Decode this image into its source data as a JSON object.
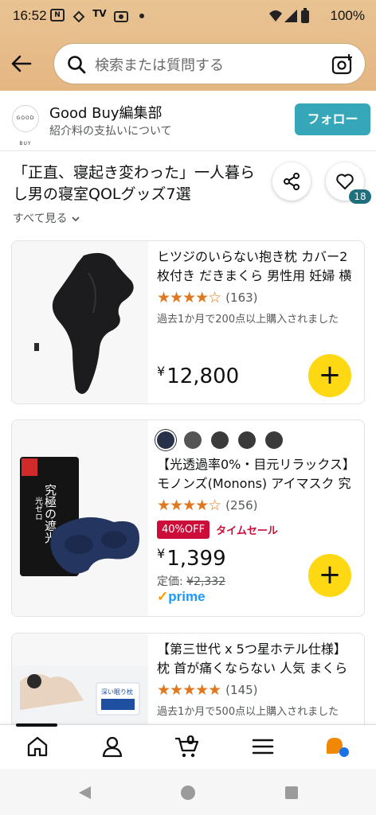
{
  "status": {
    "time": "16:52",
    "battery": "100%",
    "notif_icons": [
      "nuro-icon",
      "sync-icon",
      "tver-icon",
      "camera-app-icon"
    ]
  },
  "search": {
    "placeholder": "検索または質問する"
  },
  "influencer": {
    "name": "Good Buy編集部",
    "subtitle": "紹介料の支払いについて",
    "logo_text": "GOOD BUY",
    "follow_label": "フォロー"
  },
  "list": {
    "title": "「正直、寝起き変わった」一人暮らし男の寝室QOLグッズ7選",
    "see_all": "すべて見る",
    "likes": "18"
  },
  "products": [
    {
      "title": "ヒツジのいらない抱き枕 カバー2枚付き だきまくら 男性用 妊婦 横向き寝",
      "rating": 3.5,
      "stars": "★★★★☆",
      "reviews": "(163)",
      "bought": "過去1か月で200点以上購入されました",
      "price_symbol": "¥",
      "price": "12,800"
    },
    {
      "title": "【光透過率0%・目元リラックス】モノンズ(Monons) アイマスク 究極の遮光",
      "rating": 4.5,
      "stars": "★★★★☆",
      "reviews": "(256)",
      "deal_badge": "40%OFF",
      "deal_label": "タイムセール",
      "price_symbol": "¥",
      "price": "1,399",
      "list_label": "定価:",
      "list_price": "¥2,332",
      "prime": "prime",
      "package_text": "究極の遮光 光ゼロ",
      "swatch_colors": [
        "#27324a",
        "#555555",
        "#3a3a3a",
        "#3a3a3a",
        "#3a3a3a"
      ]
    },
    {
      "title": "【第三世代 x 5つ星ホテル仕様】枕 首が痛くならない 人気 まくら",
      "rating": 5,
      "stars": "★★★★★",
      "reviews": "(145)",
      "bought": "過去1か月で500点以上購入されました",
      "package_text": "深い眠り枕"
    }
  ],
  "nav": {
    "cart_count": "0"
  },
  "colors": {
    "accent_teal": "#35a7b8",
    "add_yellow": "#ffd814",
    "star_orange": "#de7921",
    "deal_red": "#cc0c39",
    "header_orange": "#e9c393"
  }
}
